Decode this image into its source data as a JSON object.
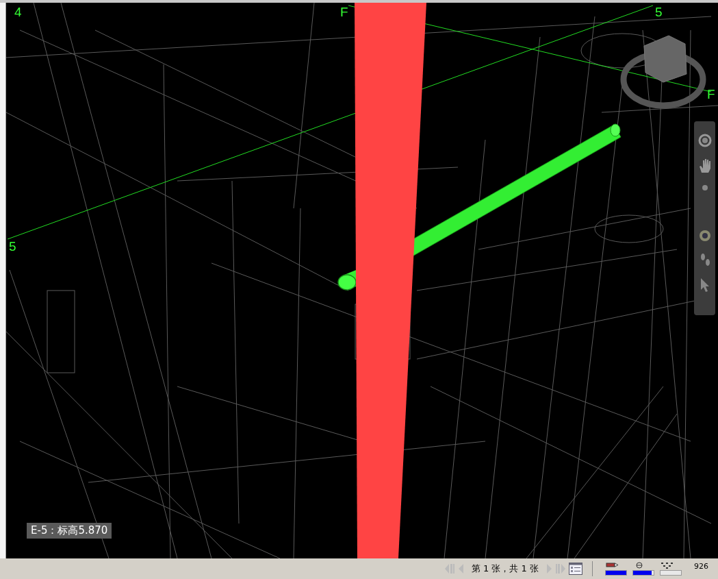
{
  "viewport": {
    "grid_labels": [
      {
        "text": "4"
      },
      {
        "text": "F"
      },
      {
        "text": "5"
      },
      {
        "text": "5"
      },
      {
        "text": "F"
      }
    ],
    "elevation_label": "E-5：标高5.870"
  },
  "status_bar": {
    "page_info": "第 1 张，共 1 张",
    "meters": [
      {
        "level": 1.0
      },
      {
        "level": 0.9
      },
      {
        "level": 0
      }
    ],
    "count": "926"
  }
}
